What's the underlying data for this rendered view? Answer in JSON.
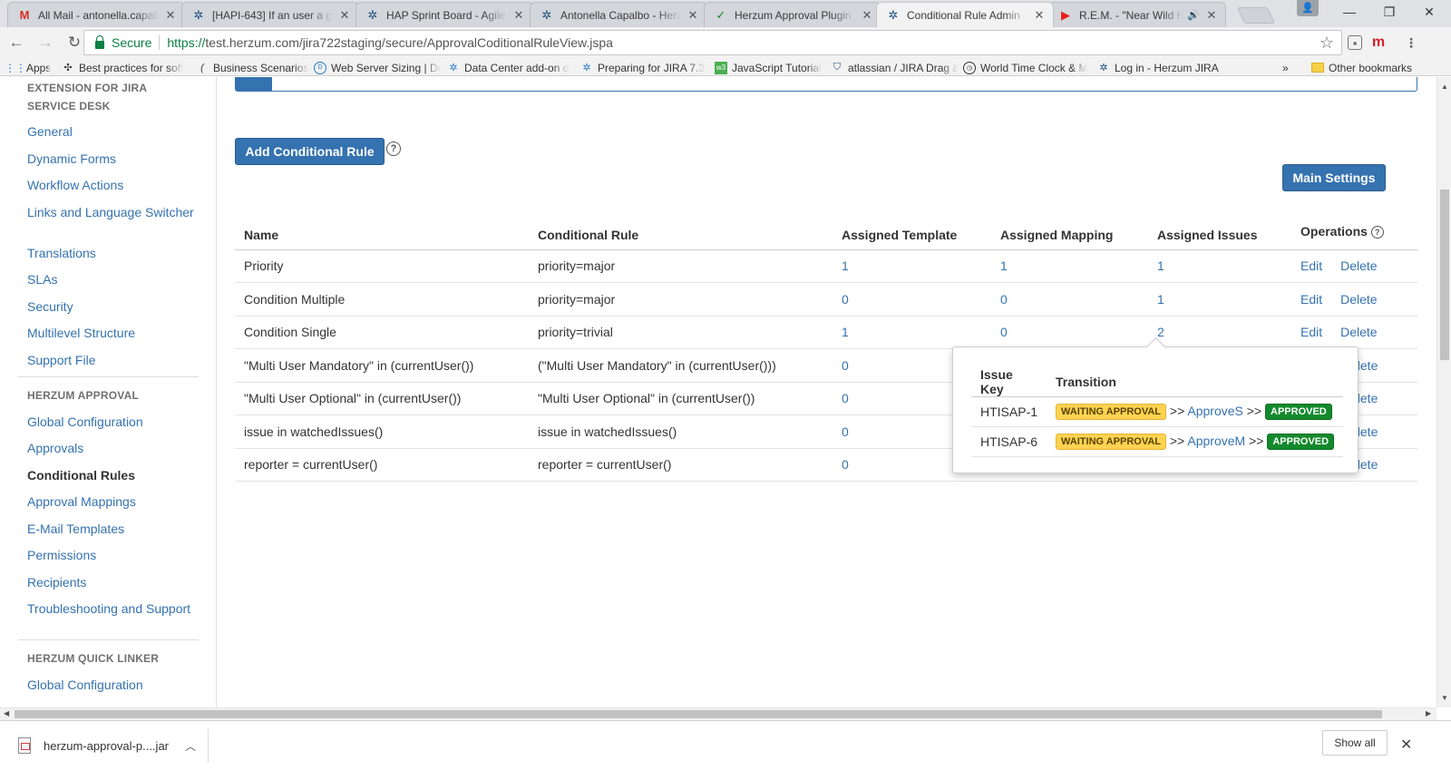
{
  "browser": {
    "tabs": [
      {
        "title": "All Mail - antonella.capalbo",
        "icon": "gmail-icon",
        "icon_glyph": "M",
        "icon_color": "#d93025",
        "active": false
      },
      {
        "title": "[HAPI-643] If an user a g",
        "icon": "jira-icon",
        "icon_glyph": "✲",
        "icon_color": "#205081",
        "active": false
      },
      {
        "title": "HAP Sprint Board - Agile",
        "icon": "jira-icon",
        "icon_glyph": "✲",
        "icon_color": "#205081",
        "active": false
      },
      {
        "title": "Antonella Capalbo - Herz",
        "icon": "jira-icon",
        "icon_glyph": "✲",
        "icon_color": "#205081",
        "active": false
      },
      {
        "title": "Herzum Approval Plugin",
        "icon": "check-circle-icon",
        "icon_glyph": "✓",
        "icon_color": "#14892c",
        "active": false
      },
      {
        "title": "Conditional Rule Admin",
        "icon": "jira-icon",
        "icon_glyph": "✲",
        "icon_color": "#205081",
        "active": true
      },
      {
        "title": "R.E.M. - \"Near Wild He",
        "icon": "youtube-icon",
        "icon_glyph": "▶",
        "icon_color": "#e62117",
        "active": false
      }
    ],
    "url": {
      "secure_label": "Secure",
      "scheme": "https://",
      "rest": "test.herzum.com/jira722staging/secure/ApprovalCoditionalRuleView.jspa"
    },
    "bookmarks": [
      {
        "label": "Apps",
        "icon": "apps-grid-icon"
      },
      {
        "label": "Best practices for soft",
        "icon": "bookmark-icon"
      },
      {
        "label": "Business Scenarios",
        "icon": "bookmark-icon"
      },
      {
        "label": "Web Server Sizing | De",
        "icon": "dell-icon"
      },
      {
        "label": "Data Center add-on d",
        "icon": "jira-icon"
      },
      {
        "label": "Preparing for JIRA 7.3",
        "icon": "jira-icon"
      },
      {
        "label": "JavaScript Tutorial",
        "icon": "w3-icon"
      },
      {
        "label": "atlassian / JIRA Drag &",
        "icon": "bitbucket-icon"
      },
      {
        "label": "World Time Clock & M",
        "icon": "clock-icon"
      },
      {
        "label": "Log in - Herzum JIRA",
        "icon": "jira-icon"
      },
      {
        "label": "Other bookmarks",
        "icon": "folder-icon"
      }
    ],
    "bookmarks_overflow": "»"
  },
  "sidebar": {
    "sections": [
      {
        "heading_lines": [
          "EXTENSION FOR JIRA",
          "SERVICE DESK"
        ],
        "items": [
          "General",
          "Dynamic Forms",
          "Workflow Actions",
          "Links and Language Switcher",
          "Translations",
          "SLAs",
          "Security",
          "Multilevel Structure",
          "Support File"
        ]
      },
      {
        "heading": "HERZUM APPROVAL",
        "items": [
          "Global Configuration",
          "Approvals",
          "Conditional Rules",
          "Approval Mappings",
          "E-Mail Templates",
          "Permissions",
          "Recipients",
          "Troubleshooting and Support"
        ],
        "active_item": "Conditional Rules"
      },
      {
        "heading": "HERZUM QUICK LINKER",
        "items": [
          "Global Configuration"
        ]
      }
    ]
  },
  "main": {
    "add_button": "Add Conditional Rule",
    "help_glyph": "?",
    "main_settings_button": "Main Settings",
    "table": {
      "headers": [
        "Name",
        "Conditional Rule",
        "Assigned Template",
        "Assigned Mapping",
        "Assigned Issues",
        "Operations"
      ],
      "rows": [
        {
          "name": "Priority",
          "rule": "priority=major",
          "template": "1",
          "mapping": "1",
          "issues": "1"
        },
        {
          "name": "Condition Multiple",
          "rule": "priority=major",
          "template": "0",
          "mapping": "0",
          "issues": "1"
        },
        {
          "name": "Condition Single",
          "rule": "priority=trivial",
          "template": "1",
          "mapping": "0",
          "issues": "2"
        },
        {
          "name": "\"Multi User Mandatory\" in (currentUser())",
          "rule": "(\"Multi User Mandatory\" in (currentUser()))",
          "template": "0",
          "mapping": "",
          "issues": ""
        },
        {
          "name": "\"Multi User Optional\" in (currentUser())",
          "rule": "\"Multi User Optional\" in (currentUser())",
          "template": "0",
          "mapping": "",
          "issues": ""
        },
        {
          "name": "issue in watchedIssues()",
          "rule": "issue in watchedIssues()",
          "template": "0",
          "mapping": "",
          "issues": ""
        },
        {
          "name": "reporter = currentUser()",
          "rule": "reporter = currentUser()",
          "template": "0",
          "mapping": "",
          "issues": ""
        }
      ],
      "edit_label": "Edit",
      "delete_label": "Delete",
      "delete_partial_label": "elete"
    },
    "popup": {
      "headers": [
        "Issue Key",
        "Transition"
      ],
      "rows": [
        {
          "key": "HTISAP-1",
          "from": "WAITING APPROVAL",
          "sep1": ">>",
          "action": "ApproveS",
          "sep2": ">>",
          "to": "APPROVED"
        },
        {
          "key": "HTISAP-6",
          "from": "WAITING APPROVAL",
          "sep1": ">>",
          "action": "ApproveM",
          "sep2": ">>",
          "to": "APPROVED"
        }
      ]
    }
  },
  "download_shelf": {
    "file_name": "herzum-approval-p....jar",
    "show_all": "Show all"
  },
  "colors": {
    "link": "#3572b0",
    "primary_button": "#3572b0",
    "waiting_lozenge": "#ffd351",
    "approved_lozenge": "#14892c"
  }
}
